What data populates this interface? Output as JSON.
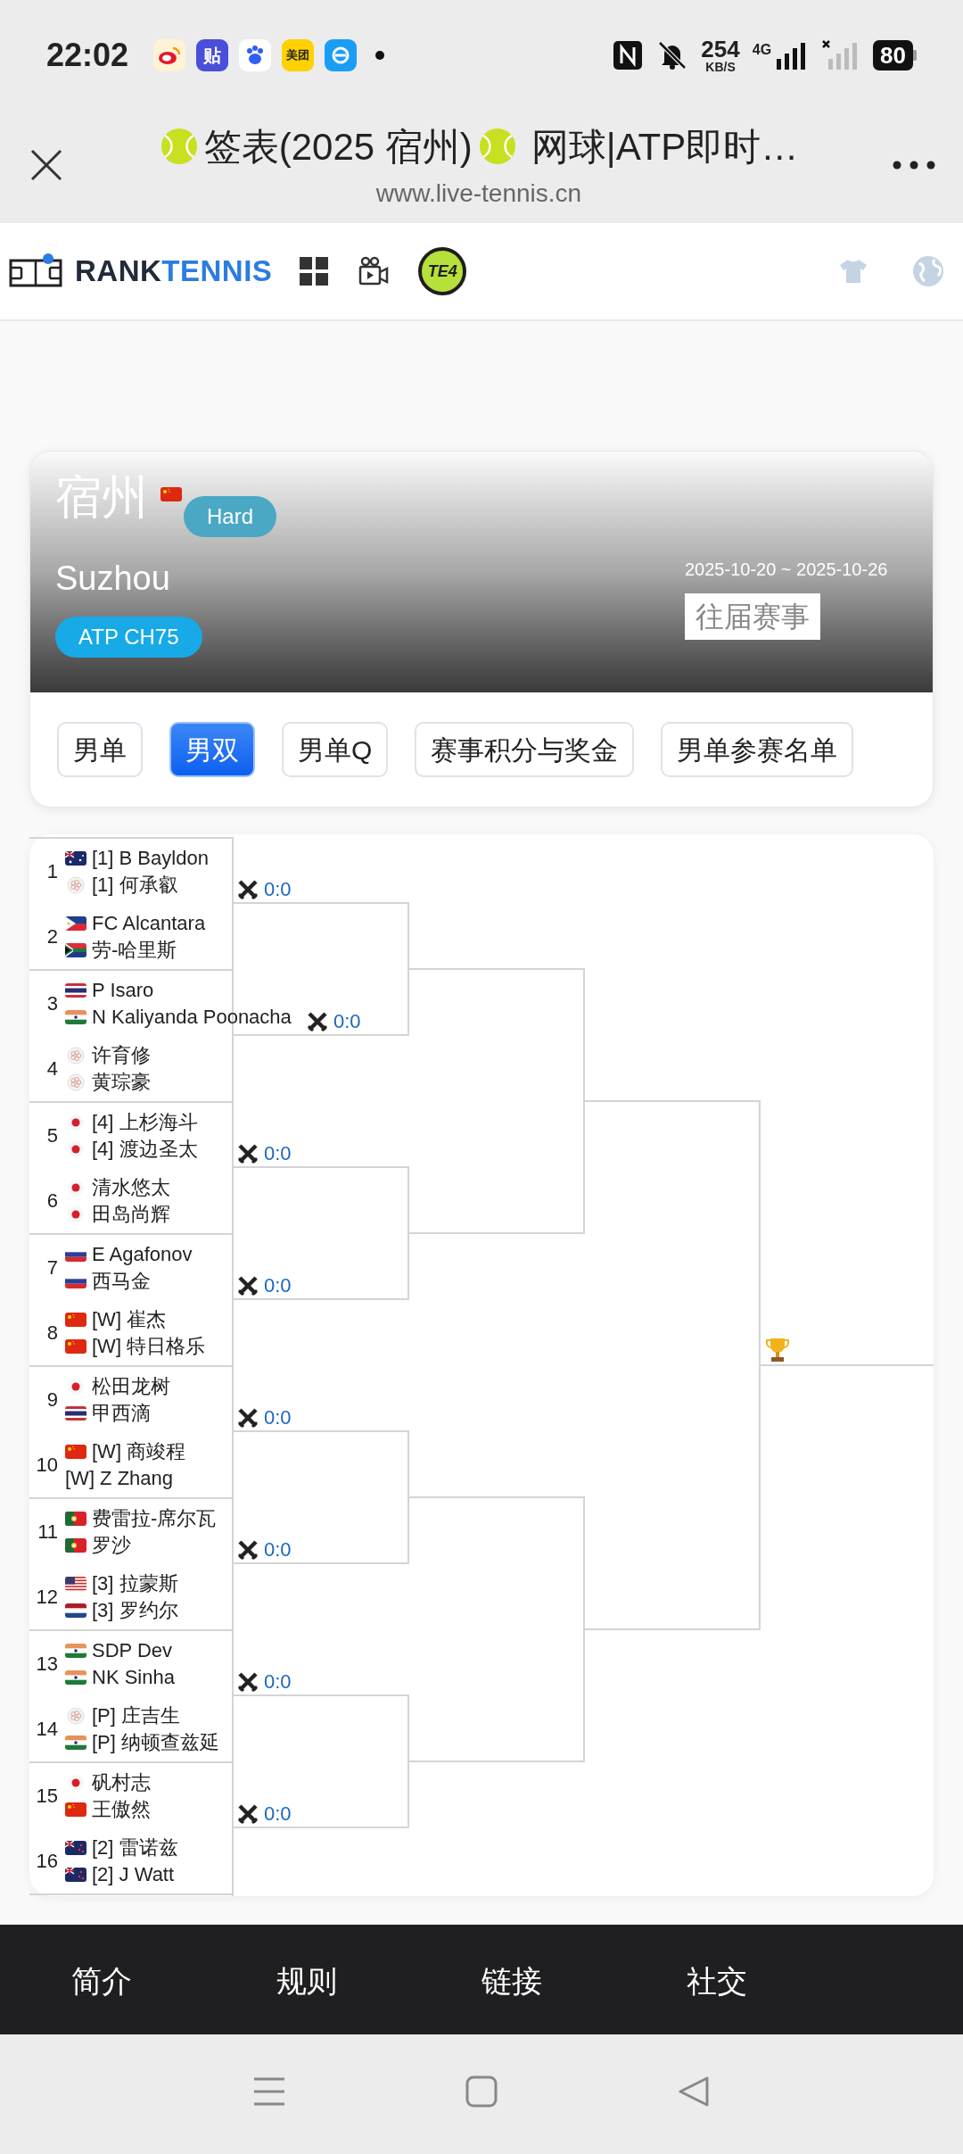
{
  "status_bar": {
    "time": "22:02",
    "apps": [
      {
        "kind": "weibo"
      },
      {
        "kind": "tieba",
        "text": "贴"
      },
      {
        "kind": "baidu"
      },
      {
        "kind": "meituan",
        "text": "美团"
      },
      {
        "kind": "eleme"
      }
    ],
    "speed": "254",
    "speed_unit": "KB/S",
    "network": "4G",
    "battery": "80"
  },
  "browser": {
    "title": [
      "签表(2025 宿州)",
      "网球|ATP即时…"
    ],
    "url": "www.live-tennis.cn"
  },
  "site_nav": {
    "logo": [
      "RANK",
      "TENNIS"
    ],
    "badge": "TE4"
  },
  "tournament": {
    "city": "宿州",
    "flag": {
      "kind": "cn"
    },
    "surface": "Hard",
    "name": "Suzhou",
    "tier": "ATP CH75",
    "dates": "2025-10-20 ~ 2025-10-26",
    "history_link": "往届赛事"
  },
  "tabs": [
    {
      "label": "男单",
      "selected": false
    },
    {
      "label": "男双",
      "selected": true
    },
    {
      "label": "男单Q",
      "selected": false
    },
    {
      "label": "赛事积分与奖金",
      "selected": false
    },
    {
      "label": "男单参赛名单",
      "selected": false
    }
  ],
  "draw": {
    "entries": [
      {
        "number": "1",
        "players": [
          {
            "flag": {
              "kind": "au"
            },
            "name": "[1] B Bayldon"
          },
          {
            "flag": {
              "kind": "tpe"
            },
            "name": "[1] 何承叡"
          }
        ]
      },
      {
        "number": "2",
        "players": [
          {
            "flag": {
              "kind": "ph"
            },
            "name": "FC Alcantara"
          },
          {
            "flag": {
              "kind": "za"
            },
            "name": "劳-哈里斯"
          }
        ]
      },
      {
        "number": "3",
        "players": [
          {
            "flag": {
              "kind": "th"
            },
            "name": "P Isaro"
          },
          {
            "flag": {
              "kind": "in"
            },
            "name": "N Kaliyanda Poonacha"
          }
        ]
      },
      {
        "number": "4",
        "players": [
          {
            "flag": {
              "kind": "tpe"
            },
            "name": "许育修"
          },
          {
            "flag": {
              "kind": "tpe"
            },
            "name": "黄琮豪"
          }
        ]
      },
      {
        "number": "5",
        "players": [
          {
            "flag": {
              "kind": "jp"
            },
            "name": "[4] 上杉海斗"
          },
          {
            "flag": {
              "kind": "jp"
            },
            "name": "[4] 渡边圣太"
          }
        ]
      },
      {
        "number": "6",
        "players": [
          {
            "flag": {
              "kind": "jp"
            },
            "name": "清水悠太"
          },
          {
            "flag": {
              "kind": "jp"
            },
            "name": "田岛尚辉"
          }
        ]
      },
      {
        "number": "7",
        "players": [
          {
            "flag": {
              "kind": "ru"
            },
            "name": "E Agafonov"
          },
          {
            "flag": {
              "kind": "ru"
            },
            "name": "西马金"
          }
        ]
      },
      {
        "number": "8",
        "players": [
          {
            "flag": {
              "kind": "cn"
            },
            "name": "[W] 崔杰"
          },
          {
            "flag": {
              "kind": "cn"
            },
            "name": "[W] 特日格乐"
          }
        ]
      },
      {
        "number": "9",
        "players": [
          {
            "flag": {
              "kind": "jp"
            },
            "name": "松田龙树"
          },
          {
            "flag": {
              "kind": "th"
            },
            "name": "甲西滴"
          }
        ]
      },
      {
        "number": "10",
        "players": [
          {
            "flag": {
              "kind": "cn"
            },
            "name": "[W] 商竣程"
          },
          {
            "name": "[W] Z Zhang"
          }
        ]
      },
      {
        "number": "11",
        "players": [
          {
            "flag": {
              "kind": "pt"
            },
            "name": "费雷拉-席尔瓦"
          },
          {
            "flag": {
              "kind": "pt"
            },
            "name": "罗沙"
          }
        ]
      },
      {
        "number": "12",
        "players": [
          {
            "flag": {
              "kind": "us"
            },
            "name": "[3] 拉蒙斯"
          },
          {
            "flag": {
              "kind": "nl"
            },
            "name": "[3] 罗约尔"
          }
        ]
      },
      {
        "number": "13",
        "players": [
          {
            "flag": {
              "kind": "in"
            },
            "name": "SDP Dev"
          },
          {
            "flag": {
              "kind": "in"
            },
            "name": "NK Sinha"
          }
        ]
      },
      {
        "number": "14",
        "players": [
          {
            "flag": {
              "kind": "tpe"
            },
            "name": "[P] 庄吉生"
          },
          {
            "flag": {
              "kind": "in"
            },
            "name": "[P] 纳顿查兹延"
          }
        ]
      },
      {
        "number": "15",
        "players": [
          {
            "flag": {
              "kind": "jp"
            },
            "name": "矾村志"
          },
          {
            "flag": {
              "kind": "cn"
            },
            "name": "王傲然"
          }
        ]
      },
      {
        "number": "16",
        "players": [
          {
            "flag": {
              "kind": "nz"
            },
            "name": "[2] 雷诺兹"
          },
          {
            "flag": {
              "kind": "nz"
            },
            "name": "[2] J Watt"
          }
        ]
      }
    ],
    "matches": [
      {
        "score": "0:0"
      },
      {
        "score": "0:0"
      },
      {
        "score": "0:0"
      },
      {
        "score": "0:0"
      },
      {
        "score": "0:0"
      },
      {
        "score": "0:0"
      },
      {
        "score": "0:0"
      },
      {
        "score": "0:0"
      }
    ]
  },
  "footer": {
    "headings": [
      "简介",
      "规则",
      "链接",
      "社交"
    ]
  }
}
